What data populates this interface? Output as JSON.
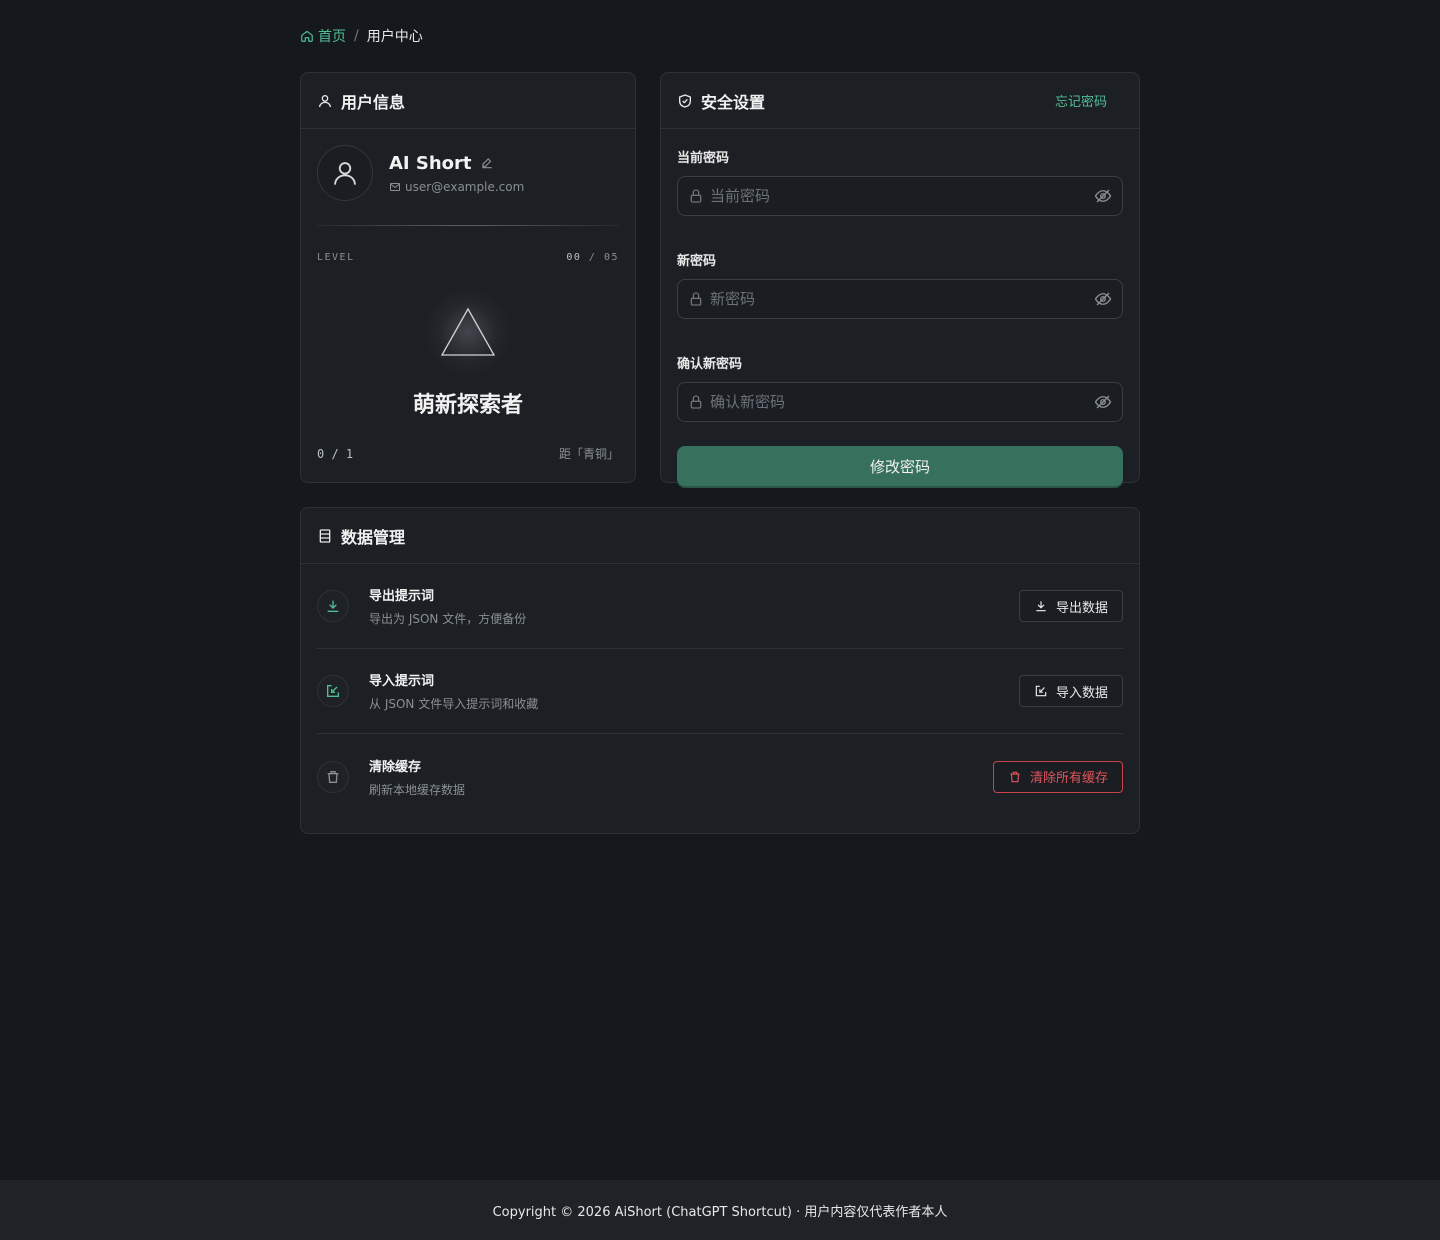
{
  "breadcrumb": {
    "home": "首页",
    "separator": "/",
    "current": "用户中心"
  },
  "user_card": {
    "title": "用户信息",
    "username": "AI Short",
    "email": "user@example.com",
    "level_label": "LEVEL",
    "level_current": "00",
    "level_sep": " / ",
    "level_max": "05",
    "rank_title": "萌新探索者",
    "progress": "0 / 1",
    "next_rank": "距「青铜」"
  },
  "security_card": {
    "title": "安全设置",
    "forgot_link": "忘记密码",
    "fields": [
      {
        "label": "当前密码",
        "placeholder": "当前密码"
      },
      {
        "label": "新密码",
        "placeholder": "新密码"
      },
      {
        "label": "确认新密码",
        "placeholder": "确认新密码"
      }
    ],
    "submit": "修改密码"
  },
  "data_card": {
    "title": "数据管理",
    "rows": [
      {
        "title": "导出提示词",
        "desc": "导出为 JSON 文件，方便备份",
        "button": "导出数据",
        "icon": "download-icon"
      },
      {
        "title": "导入提示词",
        "desc": "从 JSON 文件导入提示词和收藏",
        "button": "导入数据",
        "icon": "import-icon"
      },
      {
        "title": "清除缓存",
        "desc": "刷新本地缓存数据",
        "button": "清除所有缓存",
        "icon": "trash-icon"
      }
    ]
  },
  "footer": {
    "text": "Copyright © 2026 AiShort (ChatGPT Shortcut) · 用户内容仅代表作者本人"
  },
  "colors": {
    "accent": "#4fbf95",
    "primary_button": "#37705c",
    "danger": "#e0555b",
    "background": "#15181c",
    "card": "#1c1f24"
  }
}
